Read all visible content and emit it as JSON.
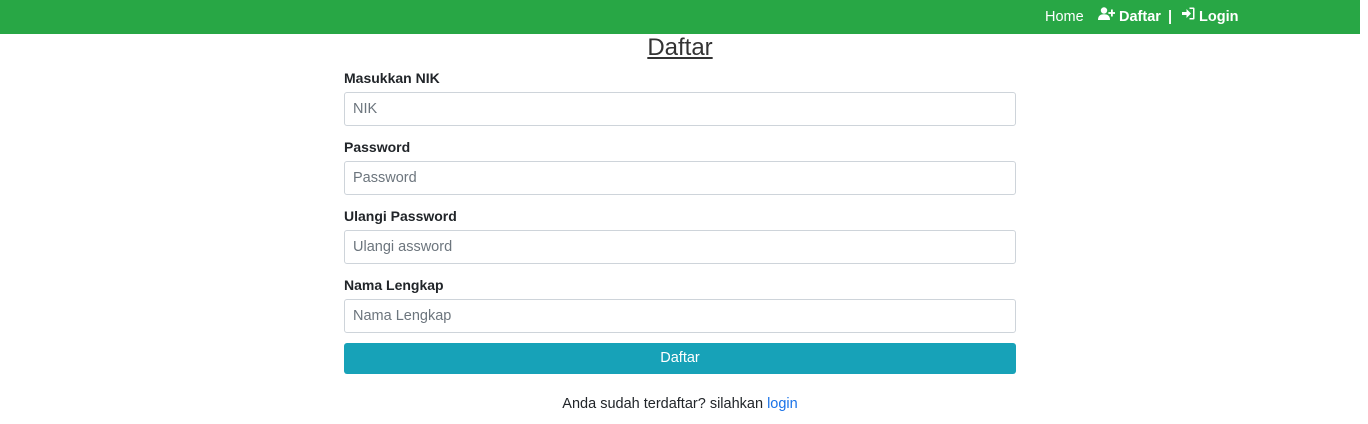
{
  "navbar": {
    "home_label": "Home",
    "daftar_label": "Daftar",
    "separator": "|",
    "login_label": "Login",
    "background_color": "#28a745",
    "daftar_icon": "user-plus-icon",
    "login_icon": "sign-in-icon"
  },
  "page": {
    "title": "Daftar"
  },
  "form": {
    "nik": {
      "label": "Masukkan NIK",
      "placeholder": "NIK"
    },
    "password": {
      "label": "Password",
      "placeholder": "Password"
    },
    "repeat_password": {
      "label": "Ulangi Password",
      "placeholder": "Ulangi assword"
    },
    "full_name": {
      "label": "Nama Lengkap",
      "placeholder": "Nama Lengkap"
    },
    "submit_label": "Daftar",
    "submit_color": "#17a2b8"
  },
  "footer": {
    "text": "Anda sudah terdaftar? silahkan",
    "link_label": "login",
    "link_color": "#1a73e8"
  }
}
